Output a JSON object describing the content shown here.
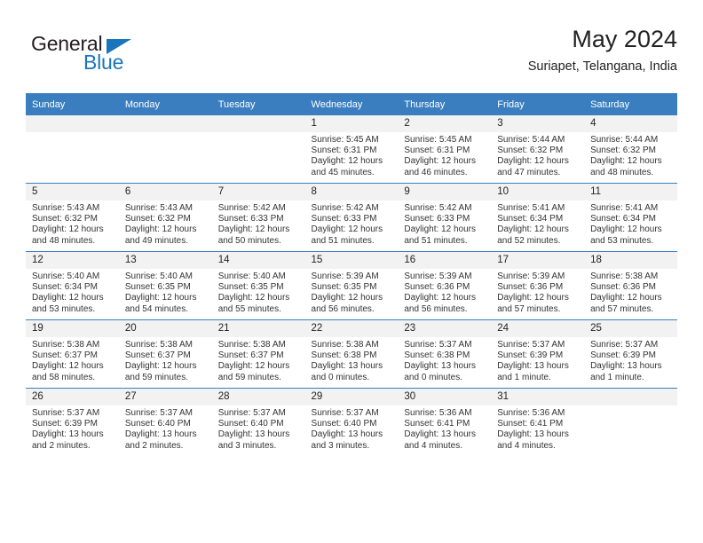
{
  "brand": {
    "name_part1": "General",
    "name_part2": "Blue",
    "triangle_color": "#1b75bb"
  },
  "header": {
    "title": "May 2024",
    "subtitle": "Suriapet, Telangana, India"
  },
  "theme": {
    "header_blue": "#3a7ebf",
    "daynum_band": "#f2f2f2",
    "text": "#333333"
  },
  "weekdays": [
    "Sunday",
    "Monday",
    "Tuesday",
    "Wednesday",
    "Thursday",
    "Friday",
    "Saturday"
  ],
  "weeks": [
    [
      {
        "day": "",
        "empty": true,
        "sunrise": "",
        "sunset": "",
        "daylight1": "",
        "daylight2": ""
      },
      {
        "day": "",
        "empty": true,
        "sunrise": "",
        "sunset": "",
        "daylight1": "",
        "daylight2": ""
      },
      {
        "day": "",
        "empty": true,
        "sunrise": "",
        "sunset": "",
        "daylight1": "",
        "daylight2": ""
      },
      {
        "day": "1",
        "empty": false,
        "sunrise": "Sunrise: 5:45 AM",
        "sunset": "Sunset: 6:31 PM",
        "daylight1": "Daylight: 12 hours",
        "daylight2": "and 45 minutes."
      },
      {
        "day": "2",
        "empty": false,
        "sunrise": "Sunrise: 5:45 AM",
        "sunset": "Sunset: 6:31 PM",
        "daylight1": "Daylight: 12 hours",
        "daylight2": "and 46 minutes."
      },
      {
        "day": "3",
        "empty": false,
        "sunrise": "Sunrise: 5:44 AM",
        "sunset": "Sunset: 6:32 PM",
        "daylight1": "Daylight: 12 hours",
        "daylight2": "and 47 minutes."
      },
      {
        "day": "4",
        "empty": false,
        "sunrise": "Sunrise: 5:44 AM",
        "sunset": "Sunset: 6:32 PM",
        "daylight1": "Daylight: 12 hours",
        "daylight2": "and 48 minutes."
      }
    ],
    [
      {
        "day": "5",
        "empty": false,
        "sunrise": "Sunrise: 5:43 AM",
        "sunset": "Sunset: 6:32 PM",
        "daylight1": "Daylight: 12 hours",
        "daylight2": "and 48 minutes."
      },
      {
        "day": "6",
        "empty": false,
        "sunrise": "Sunrise: 5:43 AM",
        "sunset": "Sunset: 6:32 PM",
        "daylight1": "Daylight: 12 hours",
        "daylight2": "and 49 minutes."
      },
      {
        "day": "7",
        "empty": false,
        "sunrise": "Sunrise: 5:42 AM",
        "sunset": "Sunset: 6:33 PM",
        "daylight1": "Daylight: 12 hours",
        "daylight2": "and 50 minutes."
      },
      {
        "day": "8",
        "empty": false,
        "sunrise": "Sunrise: 5:42 AM",
        "sunset": "Sunset: 6:33 PM",
        "daylight1": "Daylight: 12 hours",
        "daylight2": "and 51 minutes."
      },
      {
        "day": "9",
        "empty": false,
        "sunrise": "Sunrise: 5:42 AM",
        "sunset": "Sunset: 6:33 PM",
        "daylight1": "Daylight: 12 hours",
        "daylight2": "and 51 minutes."
      },
      {
        "day": "10",
        "empty": false,
        "sunrise": "Sunrise: 5:41 AM",
        "sunset": "Sunset: 6:34 PM",
        "daylight1": "Daylight: 12 hours",
        "daylight2": "and 52 minutes."
      },
      {
        "day": "11",
        "empty": false,
        "sunrise": "Sunrise: 5:41 AM",
        "sunset": "Sunset: 6:34 PM",
        "daylight1": "Daylight: 12 hours",
        "daylight2": "and 53 minutes."
      }
    ],
    [
      {
        "day": "12",
        "empty": false,
        "sunrise": "Sunrise: 5:40 AM",
        "sunset": "Sunset: 6:34 PM",
        "daylight1": "Daylight: 12 hours",
        "daylight2": "and 53 minutes."
      },
      {
        "day": "13",
        "empty": false,
        "sunrise": "Sunrise: 5:40 AM",
        "sunset": "Sunset: 6:35 PM",
        "daylight1": "Daylight: 12 hours",
        "daylight2": "and 54 minutes."
      },
      {
        "day": "14",
        "empty": false,
        "sunrise": "Sunrise: 5:40 AM",
        "sunset": "Sunset: 6:35 PM",
        "daylight1": "Daylight: 12 hours",
        "daylight2": "and 55 minutes."
      },
      {
        "day": "15",
        "empty": false,
        "sunrise": "Sunrise: 5:39 AM",
        "sunset": "Sunset: 6:35 PM",
        "daylight1": "Daylight: 12 hours",
        "daylight2": "and 56 minutes."
      },
      {
        "day": "16",
        "empty": false,
        "sunrise": "Sunrise: 5:39 AM",
        "sunset": "Sunset: 6:36 PM",
        "daylight1": "Daylight: 12 hours",
        "daylight2": "and 56 minutes."
      },
      {
        "day": "17",
        "empty": false,
        "sunrise": "Sunrise: 5:39 AM",
        "sunset": "Sunset: 6:36 PM",
        "daylight1": "Daylight: 12 hours",
        "daylight2": "and 57 minutes."
      },
      {
        "day": "18",
        "empty": false,
        "sunrise": "Sunrise: 5:38 AM",
        "sunset": "Sunset: 6:36 PM",
        "daylight1": "Daylight: 12 hours",
        "daylight2": "and 57 minutes."
      }
    ],
    [
      {
        "day": "19",
        "empty": false,
        "sunrise": "Sunrise: 5:38 AM",
        "sunset": "Sunset: 6:37 PM",
        "daylight1": "Daylight: 12 hours",
        "daylight2": "and 58 minutes."
      },
      {
        "day": "20",
        "empty": false,
        "sunrise": "Sunrise: 5:38 AM",
        "sunset": "Sunset: 6:37 PM",
        "daylight1": "Daylight: 12 hours",
        "daylight2": "and 59 minutes."
      },
      {
        "day": "21",
        "empty": false,
        "sunrise": "Sunrise: 5:38 AM",
        "sunset": "Sunset: 6:37 PM",
        "daylight1": "Daylight: 12 hours",
        "daylight2": "and 59 minutes."
      },
      {
        "day": "22",
        "empty": false,
        "sunrise": "Sunrise: 5:38 AM",
        "sunset": "Sunset: 6:38 PM",
        "daylight1": "Daylight: 13 hours",
        "daylight2": "and 0 minutes."
      },
      {
        "day": "23",
        "empty": false,
        "sunrise": "Sunrise: 5:37 AM",
        "sunset": "Sunset: 6:38 PM",
        "daylight1": "Daylight: 13 hours",
        "daylight2": "and 0 minutes."
      },
      {
        "day": "24",
        "empty": false,
        "sunrise": "Sunrise: 5:37 AM",
        "sunset": "Sunset: 6:39 PM",
        "daylight1": "Daylight: 13 hours",
        "daylight2": "and 1 minute."
      },
      {
        "day": "25",
        "empty": false,
        "sunrise": "Sunrise: 5:37 AM",
        "sunset": "Sunset: 6:39 PM",
        "daylight1": "Daylight: 13 hours",
        "daylight2": "and 1 minute."
      }
    ],
    [
      {
        "day": "26",
        "empty": false,
        "sunrise": "Sunrise: 5:37 AM",
        "sunset": "Sunset: 6:39 PM",
        "daylight1": "Daylight: 13 hours",
        "daylight2": "and 2 minutes."
      },
      {
        "day": "27",
        "empty": false,
        "sunrise": "Sunrise: 5:37 AM",
        "sunset": "Sunset: 6:40 PM",
        "daylight1": "Daylight: 13 hours",
        "daylight2": "and 2 minutes."
      },
      {
        "day": "28",
        "empty": false,
        "sunrise": "Sunrise: 5:37 AM",
        "sunset": "Sunset: 6:40 PM",
        "daylight1": "Daylight: 13 hours",
        "daylight2": "and 3 minutes."
      },
      {
        "day": "29",
        "empty": false,
        "sunrise": "Sunrise: 5:37 AM",
        "sunset": "Sunset: 6:40 PM",
        "daylight1": "Daylight: 13 hours",
        "daylight2": "and 3 minutes."
      },
      {
        "day": "30",
        "empty": false,
        "sunrise": "Sunrise: 5:36 AM",
        "sunset": "Sunset: 6:41 PM",
        "daylight1": "Daylight: 13 hours",
        "daylight2": "and 4 minutes."
      },
      {
        "day": "31",
        "empty": false,
        "sunrise": "Sunrise: 5:36 AM",
        "sunset": "Sunset: 6:41 PM",
        "daylight1": "Daylight: 13 hours",
        "daylight2": "and 4 minutes."
      },
      {
        "day": "",
        "empty": true,
        "sunrise": "",
        "sunset": "",
        "daylight1": "",
        "daylight2": ""
      }
    ]
  ]
}
